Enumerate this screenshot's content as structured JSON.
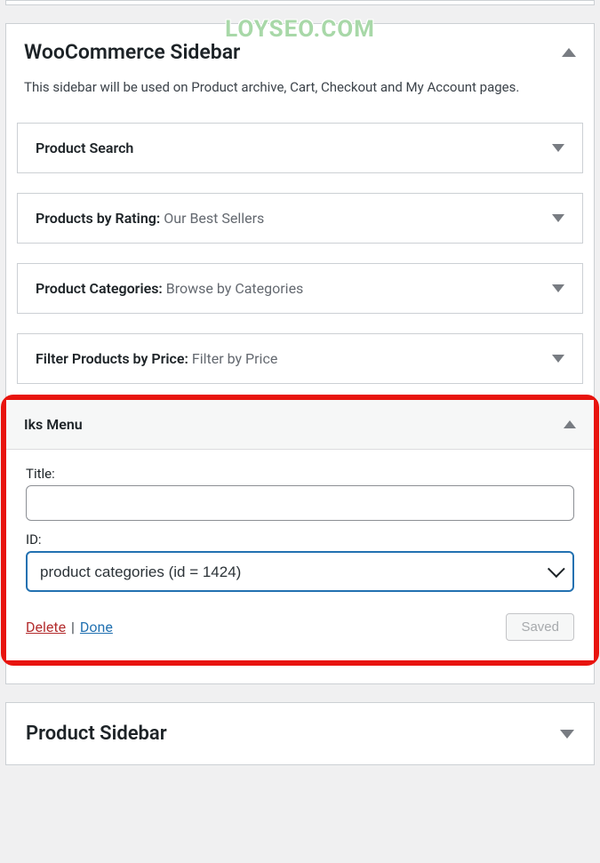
{
  "watermark": "LOYSEO.COM",
  "sidebar": {
    "title": "WooCommerce Sidebar",
    "description": "This sidebar will be used on Product archive, Cart, Checkout and My Account pages.",
    "widgets": [
      {
        "title": "Product Search",
        "subtitle": ""
      },
      {
        "title": "Products by Rating:",
        "subtitle": "Our Best Sellers"
      },
      {
        "title": "Product Categories:",
        "subtitle": "Browse by Categories"
      },
      {
        "title": "Filter Products by Price:",
        "subtitle": "Filter by Price"
      }
    ]
  },
  "iks_menu": {
    "title": "Iks Menu",
    "fields": {
      "title_label": "Title:",
      "title_value": "",
      "id_label": "ID:",
      "id_value": "product categories (id = 1424)"
    },
    "actions": {
      "delete": "Delete",
      "separator": "|",
      "done": "Done",
      "saved": "Saved"
    }
  },
  "product_sidebar": {
    "title": "Product Sidebar"
  }
}
